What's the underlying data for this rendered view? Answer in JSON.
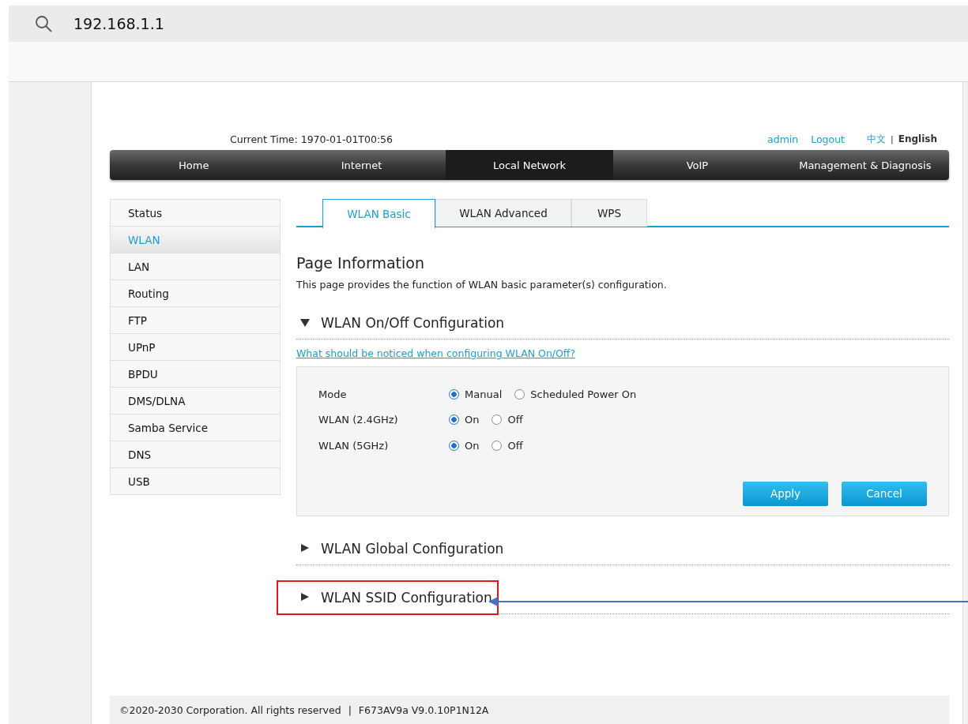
{
  "address_bar": {
    "url": "192.168.1.1"
  },
  "header": {
    "current_time": "Current Time: 1970-01-01T00:56",
    "user": "admin",
    "logout": "Logout",
    "language_separator": "|",
    "languages": [
      {
        "label": "中文",
        "selected": false
      },
      {
        "label": "English",
        "selected": true
      }
    ]
  },
  "nav": [
    {
      "label": "Home",
      "selected": false
    },
    {
      "label": "Internet",
      "selected": false
    },
    {
      "label": "Local Network",
      "selected": true
    },
    {
      "label": "VoIP",
      "selected": false
    },
    {
      "label": "Management & Diagnosis",
      "selected": false
    }
  ],
  "sidebar": [
    {
      "label": "Status",
      "selected": false
    },
    {
      "label": "WLAN",
      "selected": true
    },
    {
      "label": "LAN",
      "selected": false
    },
    {
      "label": "Routing",
      "selected": false
    },
    {
      "label": "FTP",
      "selected": false
    },
    {
      "label": "UPnP",
      "selected": false
    },
    {
      "label": "BPDU",
      "selected": false
    },
    {
      "label": "DMS/DLNA",
      "selected": false
    },
    {
      "label": "Samba Service",
      "selected": false
    },
    {
      "label": "DNS",
      "selected": false
    },
    {
      "label": "USB",
      "selected": false
    }
  ],
  "tabs": [
    {
      "label": "WLAN Basic",
      "selected": true
    },
    {
      "label": "WLAN Advanced",
      "selected": false
    },
    {
      "label": "WPS",
      "selected": false
    }
  ],
  "page_info": {
    "title": "Page Information",
    "description": "This page provides the function of WLAN basic parameter(s) configuration."
  },
  "sections": [
    {
      "title": "WLAN On/Off Configuration",
      "expanded": true,
      "highlighted": false,
      "arrow": false,
      "help_link": "What should be noticed when configuring WLAN On/Off?",
      "form": {
        "rows": [
          {
            "label": "Mode",
            "options": [
              {
                "label": "Manual",
                "selected": true
              },
              {
                "label": "Scheduled Power On",
                "selected": false
              }
            ]
          },
          {
            "label": "WLAN (2.4GHz)",
            "options": [
              {
                "label": "On",
                "selected": true
              },
              {
                "label": "Off",
                "selected": false
              }
            ]
          },
          {
            "label": "WLAN (5GHz)",
            "options": [
              {
                "label": "On",
                "selected": true
              },
              {
                "label": "Off",
                "selected": false
              }
            ]
          }
        ],
        "buttons": [
          "Apply",
          "Cancel"
        ]
      }
    },
    {
      "title": "WLAN Global Configuration",
      "expanded": false,
      "highlighted": false,
      "arrow": false
    },
    {
      "title": "WLAN SSID Configuration",
      "expanded": false,
      "highlighted": true,
      "arrow": true
    }
  ],
  "footer": {
    "copyright": "©2020-2030 Corporation. All rights reserved",
    "separator": "|",
    "version": "F673AV9a V9.0.10P1N12A"
  }
}
